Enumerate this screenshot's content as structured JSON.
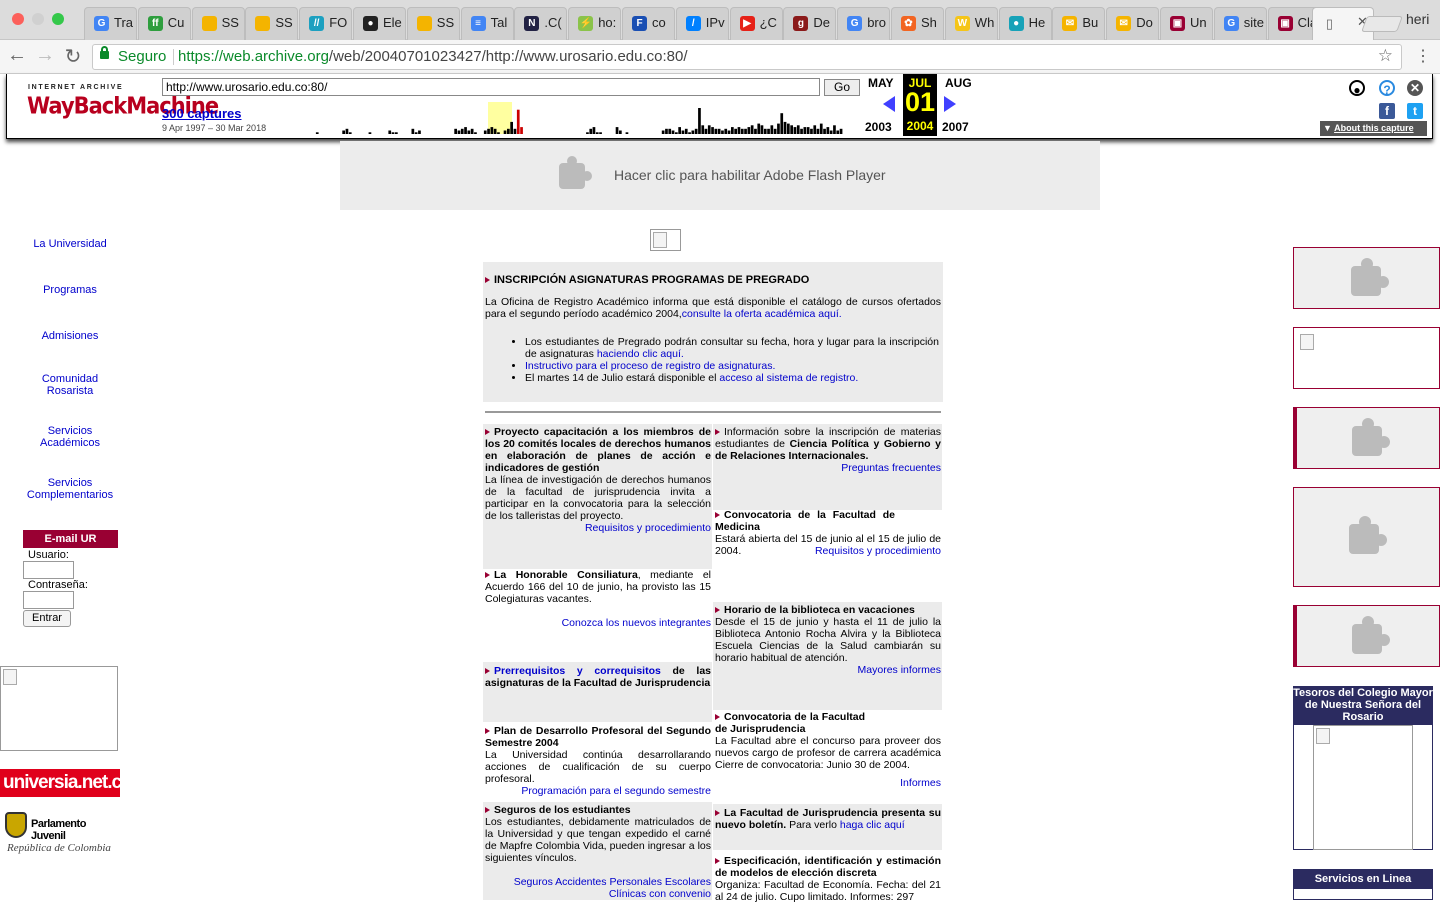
{
  "browser": {
    "tabs": [
      {
        "title": "Tra",
        "color": "#4285f4",
        "glyph": "G"
      },
      {
        "title": "Cu",
        "color": "#2e9e3e",
        "glyph": "ff"
      },
      {
        "title": "SS",
        "color": "#f4b400",
        "glyph": ""
      },
      {
        "title": "SS",
        "color": "#f4b400",
        "glyph": ""
      },
      {
        "title": "FO",
        "color": "#1ca0c0",
        "glyph": "//"
      },
      {
        "title": "Ele",
        "color": "#222222",
        "glyph": "●"
      },
      {
        "title": "SS",
        "color": "#f4b400",
        "glyph": ""
      },
      {
        "title": "Tal",
        "color": "#4285f4",
        "glyph": "≡"
      },
      {
        "title": ".C(",
        "color": "#222244",
        "glyph": "N"
      },
      {
        "title": "ho:",
        "color": "#8bc34a",
        "glyph": "⚡"
      },
      {
        "title": "co",
        "color": "#1a4fb3",
        "glyph": "F"
      },
      {
        "title": "IPv",
        "color": "#0080ff",
        "glyph": "/"
      },
      {
        "title": "¿C",
        "color": "#e62117",
        "glyph": "▶"
      },
      {
        "title": "De",
        "color": "#8b1a1a",
        "glyph": "g"
      },
      {
        "title": "bro",
        "color": "#4285f4",
        "glyph": "G"
      },
      {
        "title": "Sh",
        "color": "#f26522",
        "glyph": "✿"
      },
      {
        "title": "Wh",
        "color": "#f5c518",
        "glyph": "W"
      },
      {
        "title": "He",
        "color": "#17a2b8",
        "glyph": "●"
      },
      {
        "title": "Bu",
        "color": "#f5b400",
        "glyph": "✉"
      },
      {
        "title": "Do",
        "color": "#f5b400",
        "glyph": "✉"
      },
      {
        "title": "Un",
        "color": "#990033",
        "glyph": "▣"
      },
      {
        "title": "site",
        "color": "#4285f4",
        "glyph": "G"
      },
      {
        "title": "Cla",
        "color": "#990033",
        "glyph": "▣"
      }
    ],
    "active_tab_title": "",
    "user_name": "heri",
    "secure_label": "Seguro",
    "url_domain": "https://web.archive.org",
    "url_path": "/web/20040701023427/http://www.urosario.edu.co:80/"
  },
  "wayback": {
    "brand_top": "INTERNET ARCHIVE",
    "brand_main": "WayBackMachine",
    "url_value": "http://www.urosario.edu.co:80/",
    "go_label": "Go",
    "captures": "300 captures",
    "range": "9 Apr 1997 – 30 Mar 2018",
    "prev_month": "MAY",
    "cur_month": "JUL",
    "next_month": "AUG",
    "cur_day": "01",
    "prev_year": "2003",
    "cur_year": "2004",
    "next_year": "2007",
    "about": "About this capture",
    "capture_hist": [
      0,
      0,
      0,
      0,
      0,
      0,
      0,
      0,
      0,
      0,
      1,
      0,
      0,
      0,
      0,
      0,
      0,
      0,
      2,
      3,
      1,
      0,
      0,
      0,
      0,
      0,
      1,
      0,
      0,
      0,
      0,
      0,
      2,
      1,
      1,
      0,
      0,
      0,
      0,
      3,
      1,
      2,
      0,
      0,
      0,
      0,
      0,
      0,
      0,
      0,
      0,
      0,
      3,
      2,
      3,
      4,
      2,
      3,
      1,
      0,
      0,
      2,
      3,
      4,
      3,
      1,
      0,
      2,
      3,
      7,
      3,
      14,
      4,
      0,
      0,
      0,
      0,
      0,
      0,
      0,
      0,
      0,
      0,
      0,
      0,
      0,
      0,
      0,
      0,
      0,
      0,
      0,
      1,
      3,
      4,
      1,
      1,
      0,
      0,
      0,
      0,
      4,
      2,
      0,
      1,
      0,
      0,
      0,
      0,
      0,
      0,
      0,
      0,
      0,
      0,
      2,
      3,
      3,
      2,
      1,
      4,
      2,
      3,
      1,
      2,
      3,
      15,
      5,
      3,
      5,
      4,
      3,
      3,
      2,
      3,
      2,
      4,
      3,
      4,
      3,
      3,
      4,
      5,
      3,
      6,
      5,
      3,
      3,
      5,
      3,
      6,
      12,
      7,
      6,
      5,
      4,
      5,
      3,
      4,
      4,
      3,
      5,
      3,
      6,
      3,
      4,
      2,
      5,
      2,
      3
    ]
  },
  "flash_notice": "Hacer clic para habilitar Adobe Flash Player",
  "leftnav": [
    {
      "label": "La Universidad"
    },
    {
      "label": "Programas"
    },
    {
      "label": "Admisiones"
    },
    {
      "label": "Comunidad Rosarista"
    },
    {
      "label": "Servicios Académicos"
    },
    {
      "label": "Servicios Complementarios"
    }
  ],
  "login": {
    "title": "E-mail UR",
    "user_label": "Usuario:",
    "pass_label": "Contraseña:",
    "button": "Entrar"
  },
  "logos": {
    "universia": "universia.net.co",
    "parlamento": "Parlamento Juvenil",
    "parlamento_sub": "República de Colombia"
  },
  "main": {
    "headline": "INSCRIPCIÓN ASIGNATURAS PROGRAMAS DE PREGRADO",
    "intro": "La Oficina de Registro Académico informa que está disponible el catálogo de cursos ofertados para el segundo período académico 2004,",
    "intro_link": "consulte la oferta académica aquí.",
    "b1": "Los estudiantes de Pregrado podrán consultar su fecha, hora y lugar para la inscripción de asignaturas ",
    "b1_link": "haciendo clic aquí.",
    "b2_link": "Instructivo para el proceso de registro de asignaturas.",
    "b3": "El martes 14 de Julio estará disponible el ",
    "b3_link": "acceso al sistema de registro."
  },
  "news_left": [
    {
      "title": "Proyecto capacitación a los miembros de los 20 comités locales de derechos humanos en elaboración de planes de acción e indicadores de gestión",
      "body": "La línea de investigación de derechos humanos de la facultad de jurisprudencia invita a participar en la convocatoria para la selección de los talleristas del proyecto.",
      "link": "Requisitos y procedimiento"
    },
    {
      "title": "La Honorable Consiliatura",
      "body": ", mediante el Acuerdo 166 del 10 de junio, ha provisto las 15 Colegiaturas vacantes.",
      "link": "Conozca los nuevos integrantes"
    },
    {
      "title_link": "Prerrequisitos y correquisitos",
      "title": " de las asignaturas de la Facultad de Jurisprudencia"
    },
    {
      "title": "Plan de Desarrollo Profesoral del Segundo Semestre 2004",
      "body": "La Universidad continúa desarrollarando acciones de cualificación de su cuerpo profesoral.",
      "link": "Programación para el segundo semestre"
    },
    {
      "title": "Seguros de los estudiantes",
      "body": "Los estudiantes, debidamente matriculados de la Universidad y que tengan expedido el carné de Mapfre Colombia Vida, pueden ingresar a los siguientes vínculos.",
      "link": "Seguros Accidentes Personales Escolares",
      "link2": "Clínicas con convenio"
    }
  ],
  "news_right": [
    {
      "pre": "Información sobre la inscripción de materias estudiantes de ",
      "bold": "Ciencia Política y Gobierno y de Relaciones Internacionales.",
      "link": "Preguntas frecuentes"
    },
    {
      "title": "Convocatoria de la Facultad de Medicina",
      "body": "Estará abierta del 15 de junio al el 15 de julio de 2004.",
      "link": "Requisitos y procedimiento"
    },
    {
      "title": "Horario de la biblioteca en vacaciones",
      "body": "Desde el 15 de junio y hasta el 11 de julio la Biblioteca Antonio Rocha Alvira y la Biblioteca Escuela Ciencias de la Salud cambiarán su horario habitual de atención.",
      "link": "Mayores informes"
    },
    {
      "title": "Convocatoria de la Facultad de Jurisprudencia",
      "body": "La Facultad abre el concurso para proveer dos nuevos cargo de profesor de carrera académica Cierre de convocatoria: Junio 30 de 2004.",
      "link": "Informes"
    },
    {
      "title": "La Facultad de Jurisprudencia presenta su nuevo boletín.",
      "body": " Para verlo ",
      "link": "haga clic aquí"
    },
    {
      "title": "Especificación, identificación y estimación de modelos de elección discreta",
      "body": "Organiza: Facultad de Economía. Fecha: del 21 al 24 de julio. Cupo limitado. Informes: 297"
    }
  ],
  "right": {
    "tesoros": "Tesoros del Colegio Mayor de Nuestra Señora del Rosario",
    "servicios": "Servicios en Linea"
  }
}
